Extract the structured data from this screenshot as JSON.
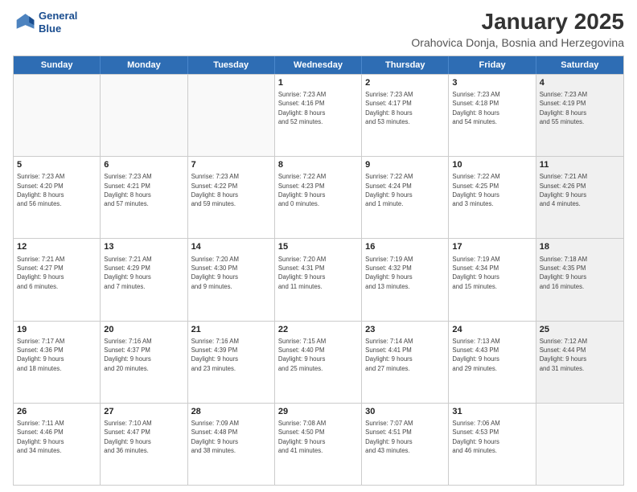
{
  "logo": {
    "line1": "General",
    "line2": "Blue"
  },
  "header": {
    "month": "January 2025",
    "location": "Orahovica Donja, Bosnia and Herzegovina"
  },
  "days_of_week": [
    "Sunday",
    "Monday",
    "Tuesday",
    "Wednesday",
    "Thursday",
    "Friday",
    "Saturday"
  ],
  "weeks": [
    [
      {
        "day": "",
        "info": "",
        "empty": true
      },
      {
        "day": "",
        "info": "",
        "empty": true
      },
      {
        "day": "",
        "info": "",
        "empty": true
      },
      {
        "day": "1",
        "info": "Sunrise: 7:23 AM\nSunset: 4:16 PM\nDaylight: 8 hours\nand 52 minutes.",
        "empty": false
      },
      {
        "day": "2",
        "info": "Sunrise: 7:23 AM\nSunset: 4:17 PM\nDaylight: 8 hours\nand 53 minutes.",
        "empty": false
      },
      {
        "day": "3",
        "info": "Sunrise: 7:23 AM\nSunset: 4:18 PM\nDaylight: 8 hours\nand 54 minutes.",
        "empty": false
      },
      {
        "day": "4",
        "info": "Sunrise: 7:23 AM\nSunset: 4:19 PM\nDaylight: 8 hours\nand 55 minutes.",
        "empty": false,
        "shaded": true
      }
    ],
    [
      {
        "day": "5",
        "info": "Sunrise: 7:23 AM\nSunset: 4:20 PM\nDaylight: 8 hours\nand 56 minutes.",
        "empty": false
      },
      {
        "day": "6",
        "info": "Sunrise: 7:23 AM\nSunset: 4:21 PM\nDaylight: 8 hours\nand 57 minutes.",
        "empty": false
      },
      {
        "day": "7",
        "info": "Sunrise: 7:23 AM\nSunset: 4:22 PM\nDaylight: 8 hours\nand 59 minutes.",
        "empty": false
      },
      {
        "day": "8",
        "info": "Sunrise: 7:22 AM\nSunset: 4:23 PM\nDaylight: 9 hours\nand 0 minutes.",
        "empty": false
      },
      {
        "day": "9",
        "info": "Sunrise: 7:22 AM\nSunset: 4:24 PM\nDaylight: 9 hours\nand 1 minute.",
        "empty": false
      },
      {
        "day": "10",
        "info": "Sunrise: 7:22 AM\nSunset: 4:25 PM\nDaylight: 9 hours\nand 3 minutes.",
        "empty": false
      },
      {
        "day": "11",
        "info": "Sunrise: 7:21 AM\nSunset: 4:26 PM\nDaylight: 9 hours\nand 4 minutes.",
        "empty": false,
        "shaded": true
      }
    ],
    [
      {
        "day": "12",
        "info": "Sunrise: 7:21 AM\nSunset: 4:27 PM\nDaylight: 9 hours\nand 6 minutes.",
        "empty": false
      },
      {
        "day": "13",
        "info": "Sunrise: 7:21 AM\nSunset: 4:29 PM\nDaylight: 9 hours\nand 7 minutes.",
        "empty": false
      },
      {
        "day": "14",
        "info": "Sunrise: 7:20 AM\nSunset: 4:30 PM\nDaylight: 9 hours\nand 9 minutes.",
        "empty": false
      },
      {
        "day": "15",
        "info": "Sunrise: 7:20 AM\nSunset: 4:31 PM\nDaylight: 9 hours\nand 11 minutes.",
        "empty": false
      },
      {
        "day": "16",
        "info": "Sunrise: 7:19 AM\nSunset: 4:32 PM\nDaylight: 9 hours\nand 13 minutes.",
        "empty": false
      },
      {
        "day": "17",
        "info": "Sunrise: 7:19 AM\nSunset: 4:34 PM\nDaylight: 9 hours\nand 15 minutes.",
        "empty": false
      },
      {
        "day": "18",
        "info": "Sunrise: 7:18 AM\nSunset: 4:35 PM\nDaylight: 9 hours\nand 16 minutes.",
        "empty": false,
        "shaded": true
      }
    ],
    [
      {
        "day": "19",
        "info": "Sunrise: 7:17 AM\nSunset: 4:36 PM\nDaylight: 9 hours\nand 18 minutes.",
        "empty": false
      },
      {
        "day": "20",
        "info": "Sunrise: 7:16 AM\nSunset: 4:37 PM\nDaylight: 9 hours\nand 20 minutes.",
        "empty": false
      },
      {
        "day": "21",
        "info": "Sunrise: 7:16 AM\nSunset: 4:39 PM\nDaylight: 9 hours\nand 23 minutes.",
        "empty": false
      },
      {
        "day": "22",
        "info": "Sunrise: 7:15 AM\nSunset: 4:40 PM\nDaylight: 9 hours\nand 25 minutes.",
        "empty": false
      },
      {
        "day": "23",
        "info": "Sunrise: 7:14 AM\nSunset: 4:41 PM\nDaylight: 9 hours\nand 27 minutes.",
        "empty": false
      },
      {
        "day": "24",
        "info": "Sunrise: 7:13 AM\nSunset: 4:43 PM\nDaylight: 9 hours\nand 29 minutes.",
        "empty": false
      },
      {
        "day": "25",
        "info": "Sunrise: 7:12 AM\nSunset: 4:44 PM\nDaylight: 9 hours\nand 31 minutes.",
        "empty": false,
        "shaded": true
      }
    ],
    [
      {
        "day": "26",
        "info": "Sunrise: 7:11 AM\nSunset: 4:46 PM\nDaylight: 9 hours\nand 34 minutes.",
        "empty": false
      },
      {
        "day": "27",
        "info": "Sunrise: 7:10 AM\nSunset: 4:47 PM\nDaylight: 9 hours\nand 36 minutes.",
        "empty": false
      },
      {
        "day": "28",
        "info": "Sunrise: 7:09 AM\nSunset: 4:48 PM\nDaylight: 9 hours\nand 38 minutes.",
        "empty": false
      },
      {
        "day": "29",
        "info": "Sunrise: 7:08 AM\nSunset: 4:50 PM\nDaylight: 9 hours\nand 41 minutes.",
        "empty": false
      },
      {
        "day": "30",
        "info": "Sunrise: 7:07 AM\nSunset: 4:51 PM\nDaylight: 9 hours\nand 43 minutes.",
        "empty": false
      },
      {
        "day": "31",
        "info": "Sunrise: 7:06 AM\nSunset: 4:53 PM\nDaylight: 9 hours\nand 46 minutes.",
        "empty": false
      },
      {
        "day": "",
        "info": "",
        "empty": true,
        "shaded": true
      }
    ]
  ]
}
